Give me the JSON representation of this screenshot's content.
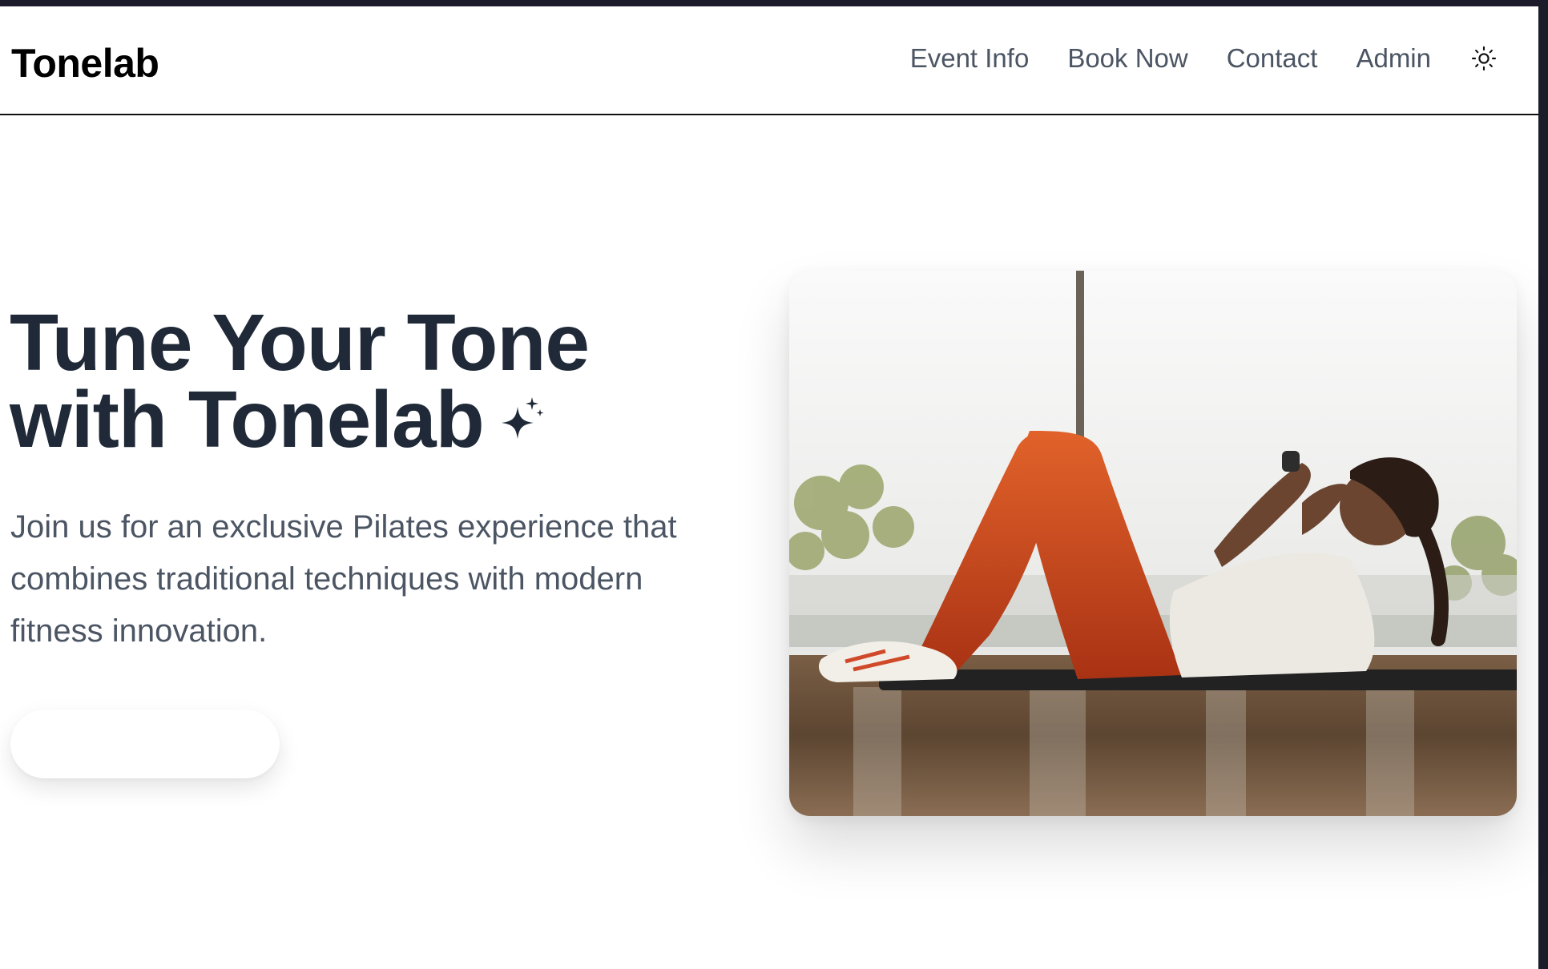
{
  "header": {
    "brand": "Tonelab",
    "nav": [
      {
        "label": "Event Info"
      },
      {
        "label": "Book Now"
      },
      {
        "label": "Contact"
      },
      {
        "label": "Admin"
      }
    ],
    "theme_toggle_icon": "sun-icon"
  },
  "hero": {
    "title_line1": "Tune Your Tone",
    "title_line2": "with Tonelab",
    "title_icon": "sparkles-icon",
    "subtitle": "Join us for an exclusive Pilates experience that combines traditional techniques with modern fitness innovation.",
    "cta_label": "",
    "image_subject": "woman-doing-crunches-photo"
  },
  "colors": {
    "heading": "#1f2937",
    "body_text": "#4b5563",
    "frame": "#1b1b2b",
    "leggings": "#d2541f"
  }
}
